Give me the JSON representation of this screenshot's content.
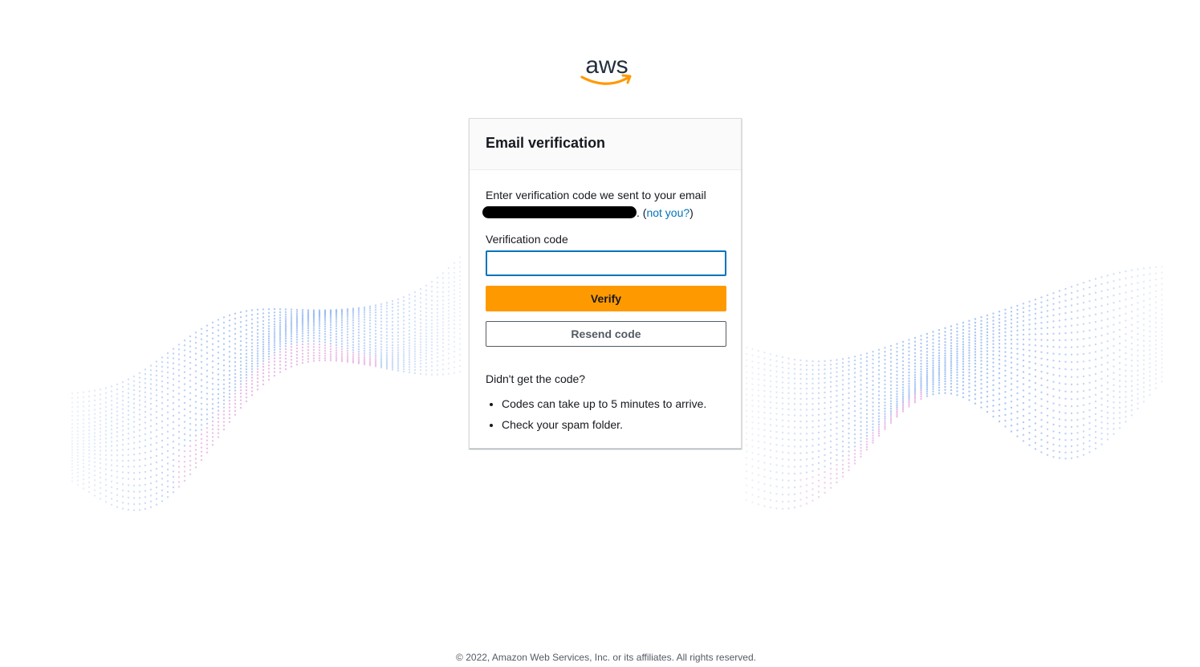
{
  "brand": {
    "logo_text": "aws",
    "accent_color": "#ff9900",
    "logo_text_color": "#232f3e"
  },
  "card": {
    "title": "Email verification",
    "instruction": "Enter verification code we sent to your email",
    "redacted_email_suffix": ".",
    "not_you_prefix": " (",
    "not_you_link": "not you?",
    "not_you_suffix": ")",
    "field_label": "Verification code",
    "code_value": "",
    "verify_label": "Verify",
    "resend_label": "Resend code",
    "help_title": "Didn't get the code?",
    "help_items": [
      "Codes can take up to 5 minutes to arrive.",
      "Check your spam folder."
    ]
  },
  "footer": {
    "copyright": "© 2022, Amazon Web Services, Inc. or its affiliates. All rights reserved."
  },
  "colors": {
    "link": "#0073bb",
    "input_focus_border": "#0073bb",
    "background_dots_blue": "#7aa6f0",
    "background_dots_pink": "#d98fd6"
  }
}
